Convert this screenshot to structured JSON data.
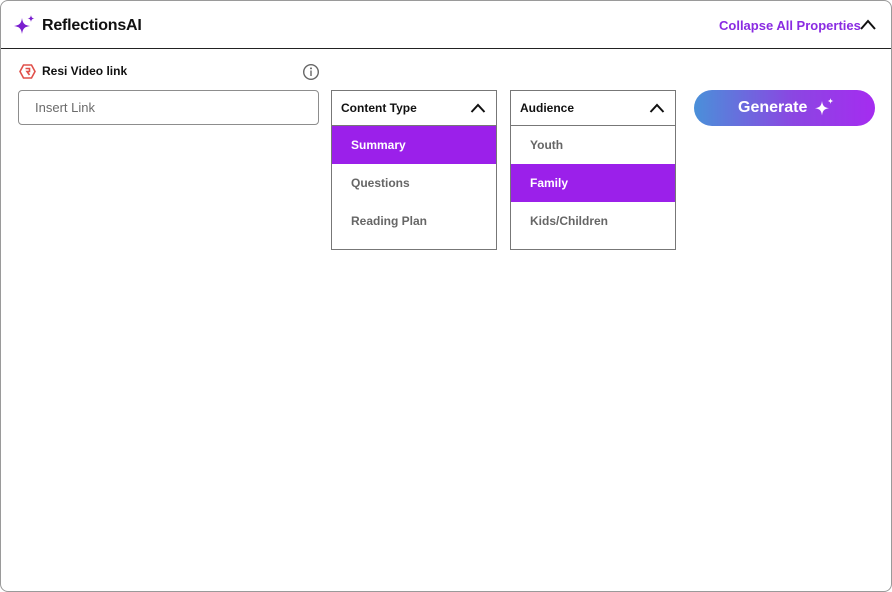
{
  "header": {
    "title": "ReflectionsAI",
    "brand_icon": "sparkle-icon",
    "collapse_label": "Collapse All Properties",
    "collapse_icon": "chevron-up-icon",
    "accent_color": "#8a2be2"
  },
  "resi": {
    "label": "Resi Video link",
    "icon": "resi-logo-icon",
    "info_icon": "info-icon",
    "input_value": "",
    "input_placeholder": "Insert Link"
  },
  "content_type": {
    "label": "Content Type",
    "expanded": true,
    "options": [
      {
        "label": "Summary",
        "selected": true
      },
      {
        "label": "Questions",
        "selected": false
      },
      {
        "label": "Reading Plan",
        "selected": false
      }
    ]
  },
  "audience": {
    "label": "Audience",
    "expanded": true,
    "options": [
      {
        "label": "Youth",
        "selected": false
      },
      {
        "label": "Family",
        "selected": true
      },
      {
        "label": "Kids/Children",
        "selected": false
      }
    ]
  },
  "generate": {
    "label": "Generate",
    "icon": "sparkle-icon"
  },
  "colors": {
    "selected_bg": "#9b20ea",
    "gradient_start": "#4a90d9",
    "gradient_end": "#a52cf0"
  }
}
